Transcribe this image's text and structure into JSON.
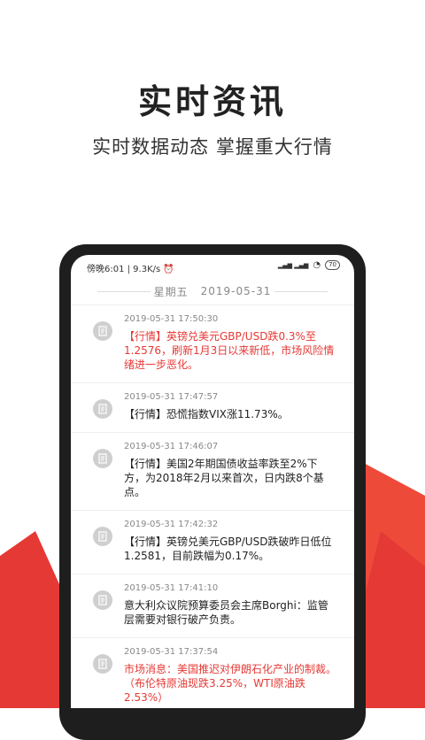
{
  "promo": {
    "headline": "实时资讯",
    "subline": "实时数据动态 掌握重大行情"
  },
  "status_bar": {
    "left": "傍晚6:01 | 9.3K/s ⏰",
    "signal": "▂▄▆ ▂▄▆",
    "wifi": "◔",
    "battery": "70"
  },
  "date_bar": {
    "weekday": "星期五",
    "date": "2019-05-31"
  },
  "colors": {
    "accent_red": "#e53935",
    "text_dark": "#222222"
  },
  "news": [
    {
      "time": "2019-05-31 17:50:30",
      "text": "【行情】英镑兑美元GBP/USD跌0.3%至1.2576，刷新1月3日以来新低，市场风险情绪进一步恶化。",
      "highlight": true
    },
    {
      "time": "2019-05-31 17:47:57",
      "text": "【行情】恐慌指数VIX涨11.73%。",
      "highlight": false
    },
    {
      "time": "2019-05-31 17:46:07",
      "text": "【行情】美国2年期国债收益率跌至2%下方，为2018年2月以来首次，日内跌8个基点。",
      "highlight": false
    },
    {
      "time": "2019-05-31 17:42:32",
      "text": "【行情】英镑兑美元GBP/USD跌破昨日低位1.2581，目前跌幅为0.17%。",
      "highlight": false
    },
    {
      "time": "2019-05-31 17:41:10",
      "text": "意大利众议院预算委员会主席Borghi：监管层需要对银行破产负责。",
      "highlight": false
    },
    {
      "time": "2019-05-31 17:37:54",
      "text": "市场消息：美国推迟对伊朗石化产业的制裁。（布伦特原油现跌3.25%，WTI原油跌2.53%）",
      "highlight": true
    }
  ]
}
